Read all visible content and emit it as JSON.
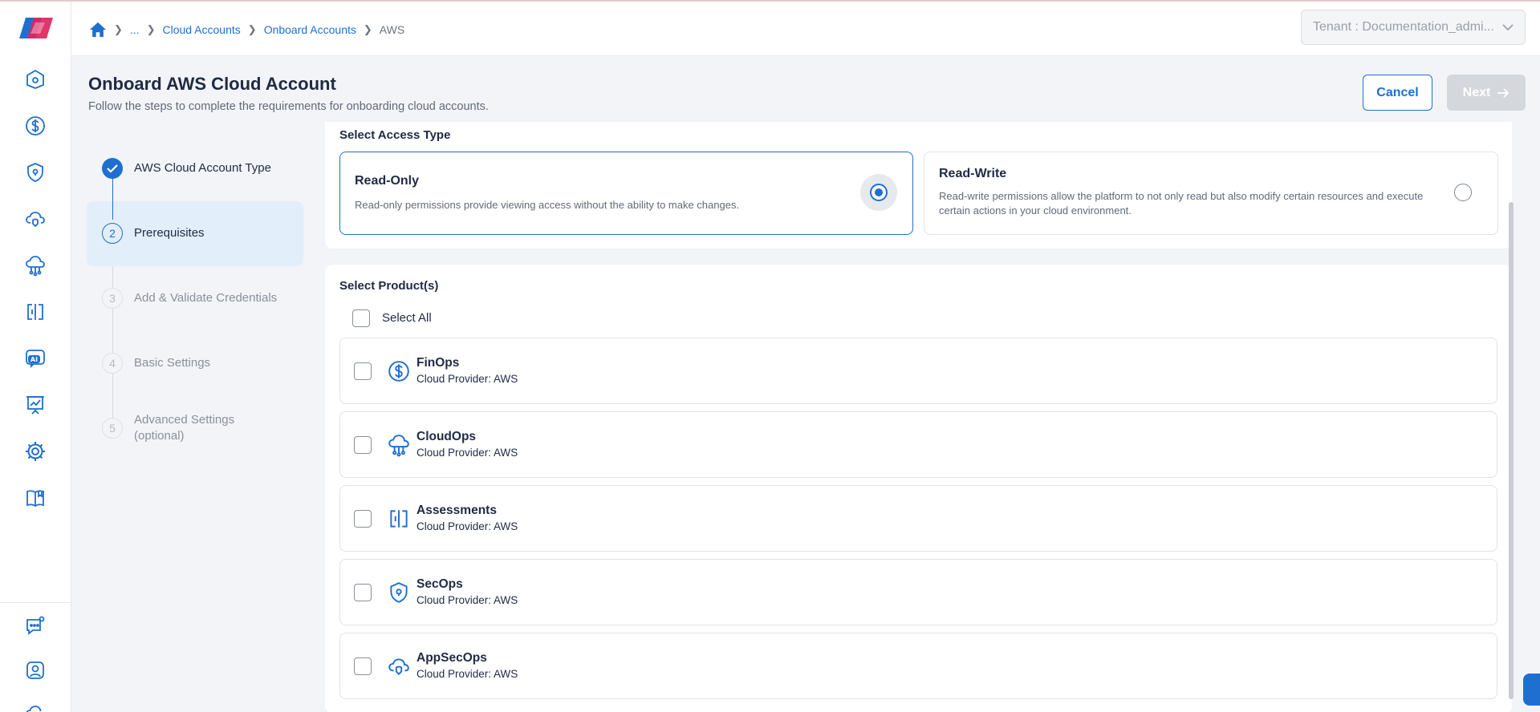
{
  "breadcrumb": {
    "items": [
      "...",
      "Cloud Accounts",
      "Onboard Accounts",
      "AWS"
    ]
  },
  "tenant": {
    "label": "Tenant : Documentation_admi..."
  },
  "header": {
    "title": "Onboard AWS Cloud Account",
    "subtitle": "Follow the steps to complete the requirements for onboarding cloud accounts.",
    "cancel_label": "Cancel",
    "next_label": "Next"
  },
  "steps": [
    {
      "number": "1",
      "label": "AWS Cloud Account Type",
      "state": "done"
    },
    {
      "number": "2",
      "label": "Prerequisites",
      "state": "active"
    },
    {
      "number": "3",
      "label": "Add & Validate Credentials",
      "state": "pending"
    },
    {
      "number": "4",
      "label": "Basic Settings",
      "state": "pending"
    },
    {
      "number": "5",
      "label": "Advanced Settings (optional)",
      "state": "pending"
    }
  ],
  "access": {
    "title": "Select Access Type",
    "options": [
      {
        "title": "Read-Only",
        "desc": "Read-only permissions provide viewing access without the ability to make changes.",
        "selected": true
      },
      {
        "title": "Read-Write",
        "desc": "Read-write permissions allow the platform to not only read but also modify certain resources and execute certain actions in your cloud environment.",
        "selected": false
      }
    ]
  },
  "products": {
    "title": "Select Product(s)",
    "select_all": "Select All",
    "items": [
      {
        "name": "FinOps",
        "provider": "Cloud Provider: AWS",
        "icon": "dollar-icon"
      },
      {
        "name": "CloudOps",
        "provider": "Cloud Provider: AWS",
        "icon": "cloud-network-icon"
      },
      {
        "name": "Assessments",
        "provider": "Cloud Provider: AWS",
        "icon": "assessment-icon"
      },
      {
        "name": "SecOps",
        "provider": "Cloud Provider: AWS",
        "icon": "shield-icon"
      },
      {
        "name": "AppSecOps",
        "provider": "Cloud Provider: AWS",
        "icon": "cloud-shield-icon"
      }
    ]
  },
  "colors": {
    "accent": "#1f6fd0",
    "active_step_bg": "#e3eefb",
    "disabled": "#d4d7dc"
  }
}
